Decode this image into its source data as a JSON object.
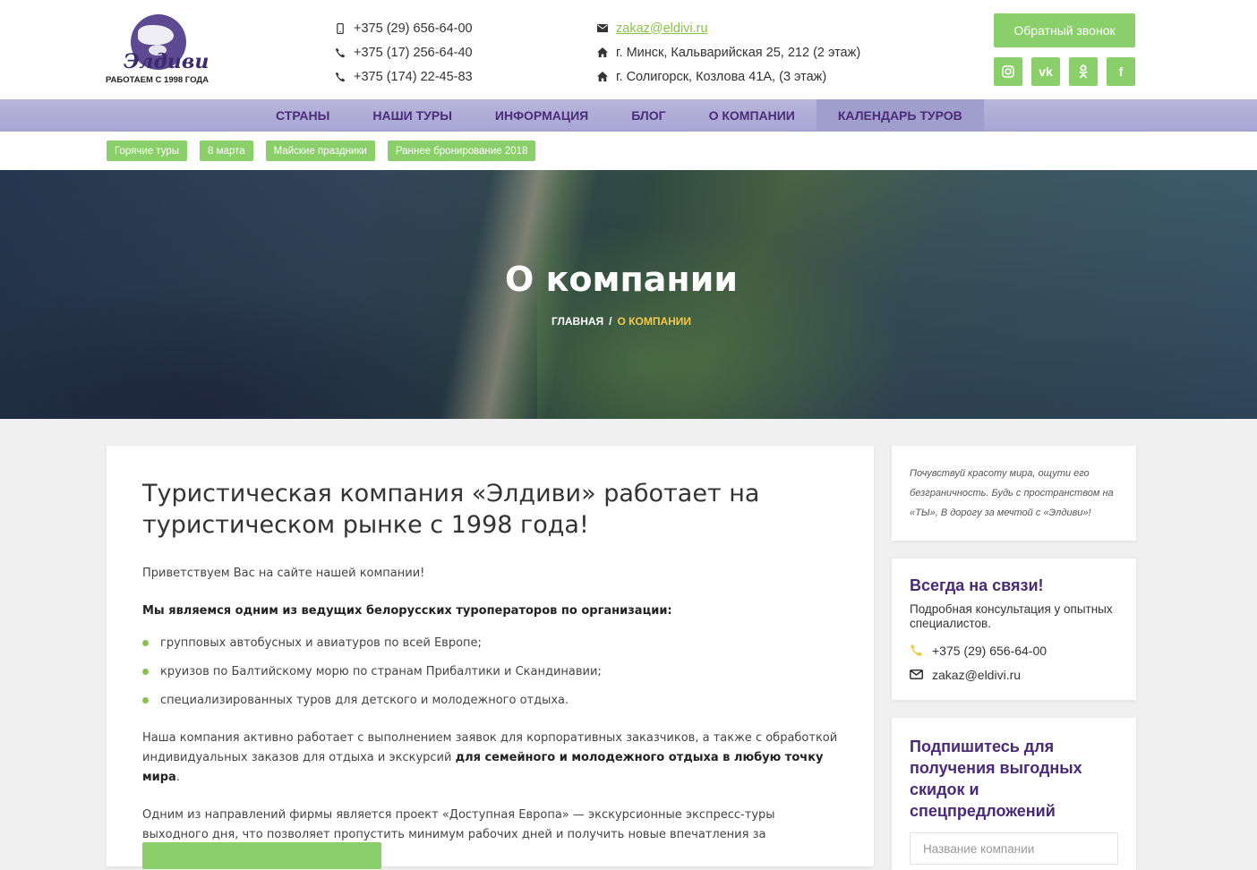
{
  "logo": {
    "name": "Элдиви",
    "tagline": "РАБОТАЕМ С 1998 ГОДА"
  },
  "header": {
    "phones": [
      {
        "icon": "mobile-icon",
        "text": "+375 (29) 656-64-00"
      },
      {
        "icon": "phone-icon",
        "text": "+375 (17) 256-64-40"
      },
      {
        "icon": "phone-icon",
        "text": "+375 (174) 22-45-83"
      }
    ],
    "email": "zakaz@eldivi.ru",
    "addresses": [
      "г. Минск, Кальварийская 25, 212 (2 этаж)",
      "г. Солигорск, Козлова 41А, (3 этаж)"
    ],
    "callback_label": "Обратный звонок",
    "socials": [
      {
        "name": "instagram-icon",
        "glyph": "◙"
      },
      {
        "name": "vk-icon",
        "glyph": "vk"
      },
      {
        "name": "odnoklassniki-icon",
        "glyph": "ok"
      },
      {
        "name": "facebook-icon",
        "glyph": "f"
      }
    ]
  },
  "nav": {
    "items": [
      "СТРАНЫ",
      "НАШИ ТУРЫ",
      "ИНФОРМАЦИЯ",
      "БЛОГ",
      "О КОМПАНИИ",
      "КАЛЕНДАРЬ ТУРОВ"
    ],
    "active_index": 5
  },
  "tags": [
    "Горячие туры",
    "8 марта",
    "Майские праздники",
    "Раннее бронирование 2018"
  ],
  "hero": {
    "title": "О компании",
    "breadcrumb": {
      "home": "ГЛАВНАЯ",
      "separator": "/",
      "current": "О КОМПАНИИ"
    }
  },
  "main": {
    "title": "Туристическая компания «Элдиви» работает на туристическом рынке с 1998 года!",
    "greeting": "Приветствуем Вас на сайте нашей компании!",
    "lead": "Мы являемся одним из ведущих белорусских туроператоров по организации:",
    "list": [
      "групповых автобусных и авиатуров по всей Европе;",
      "круизов по Балтийскому морю по странам Прибалтики и Скандинавии;",
      "специализированных туров для детского и молодежного отдыха."
    ],
    "para1_start": "Наша компания активно работает с выполнением заявок для корпоративных заказчиков, а также с обработкой индивидуальных заказов для отдыха и экскурсий ",
    "para1_bold": "для семейного и молодежного отдыха в любую точку мира",
    "para1_end": ".",
    "para2": "Одним из направлений фирмы является проект «Доступная Европа» — экскурсионные экспресс-туры выходного дня, что позволяет пропустить минимум рабочих дней и получить новые впечатления за адекватную стоимость."
  },
  "sidebar": {
    "quote": "Почувствуй красоту мира, ощути его безграничность. Будь с пространством на «ТЫ», В дорогу за мечтой с «Элдиви»!",
    "contact": {
      "title": "Всегда на связи!",
      "text": "Подробная консультация у опытных специалистов.",
      "phone": "+375 (29) 656-64-00",
      "email": "zakaz@eldivi.ru"
    },
    "subscribe": {
      "title": "Подпишитесь для получения выгодных скидок и спецпредложений",
      "placeholder": "Название компании"
    }
  },
  "colors": {
    "accent_green": "#8bcf6a",
    "brand_purple": "#4b2c78",
    "nav_bg": "#b1afd8",
    "breadcrumb_current": "#f2c94c"
  }
}
